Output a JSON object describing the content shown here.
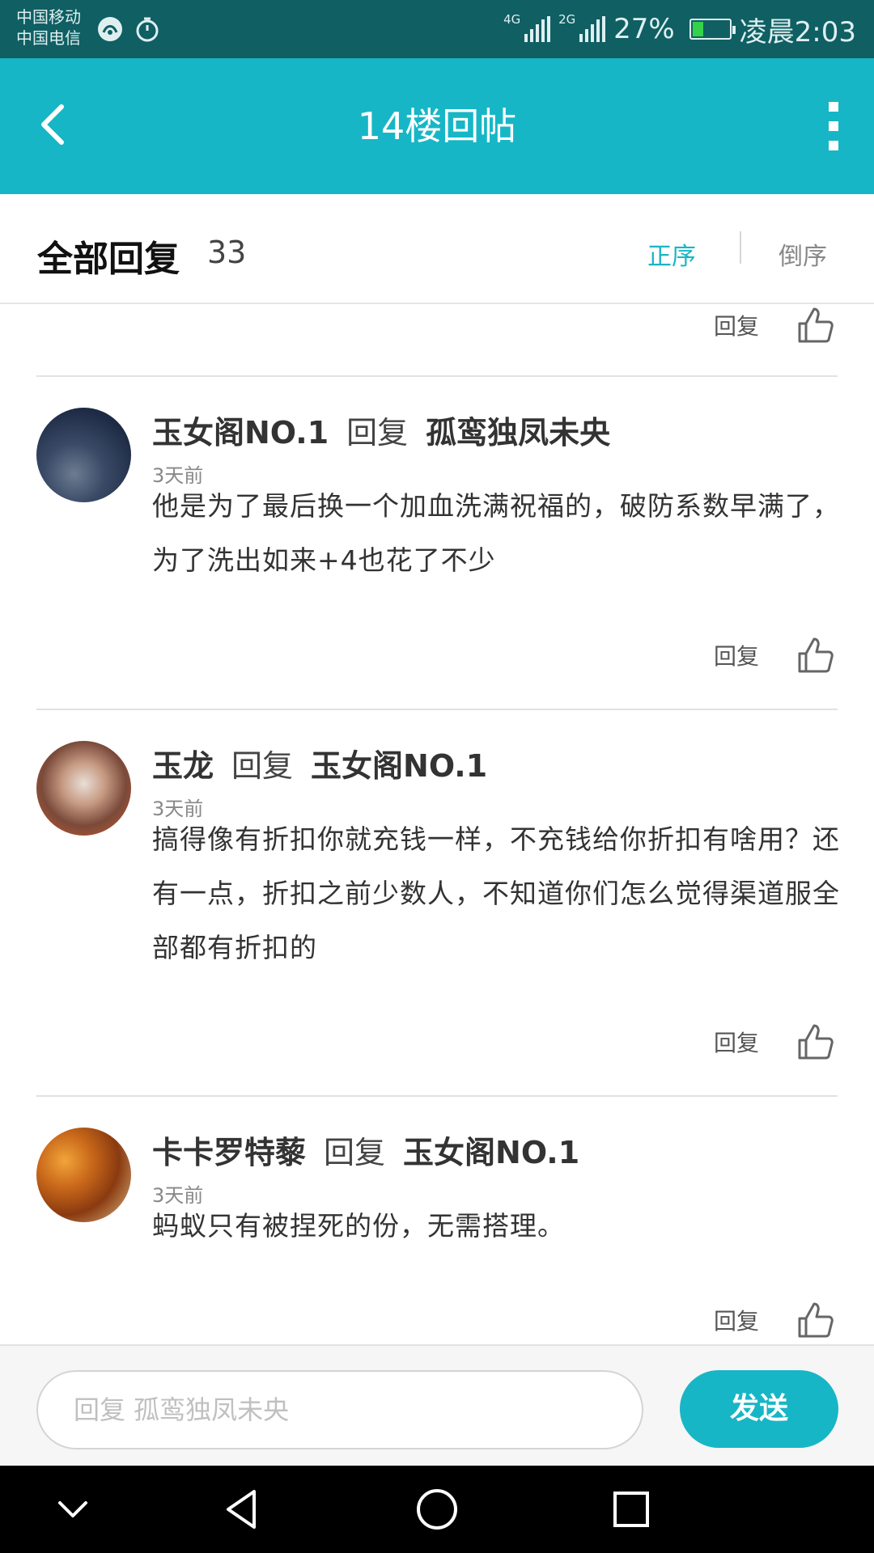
{
  "status_bar": {
    "carrier_1": "中国移动",
    "carrier_2": "中国电信",
    "net_1": "4G",
    "net_2": "2G",
    "battery": "27%",
    "battery_level": 0.27,
    "time": "凌晨2:03",
    "icons": [
      "wifi-hotspot-icon",
      "alarm-icon",
      "signal-icon",
      "battery-icon"
    ]
  },
  "header": {
    "title": "14楼回帖",
    "back_icon": "chevron-left-icon",
    "more_icon": "more-vertical-icon"
  },
  "sort_bar": {
    "title": "全部回复",
    "count": "33",
    "asc_label": "正序",
    "desc_label": "倒序"
  },
  "colors": {
    "accent": "#17b6c6",
    "status_bar": "#0f5f63"
  },
  "comments": [
    {
      "user": "玉女阁NO.1",
      "reply_word": "回复",
      "reply_to": "孤鸾独凤未央",
      "time": "3天前",
      "body": "他是为了最后换一个加血洗满祝福的，破防系数早满了，为了洗出如来+4也花了不少",
      "reply_label": "回复"
    },
    {
      "user": "玉龙",
      "reply_word": "回复",
      "reply_to": "玉女阁NO.1",
      "time": "3天前",
      "body": "搞得像有折扣你就充钱一样，不充钱给你折扣有啥用？还有一点，折扣之前少数人，不知道你们怎么觉得渠道服全部都有折扣的",
      "reply_label": "回复"
    },
    {
      "user": "卡卡罗特藜",
      "reply_word": "回复",
      "reply_to": "玉女阁NO.1",
      "time": "3天前",
      "body": "蚂蚁只有被捏死的份，无需搭理。",
      "reply_label": "回复"
    }
  ],
  "top_partial": {
    "reply_label": "回复"
  },
  "input_bar": {
    "placeholder": "回复  孤鸾独凤未央",
    "send_label": "发送"
  },
  "nav": {
    "icons": [
      "nav-down-icon",
      "nav-back-icon",
      "nav-home-icon",
      "nav-recents-icon"
    ]
  }
}
